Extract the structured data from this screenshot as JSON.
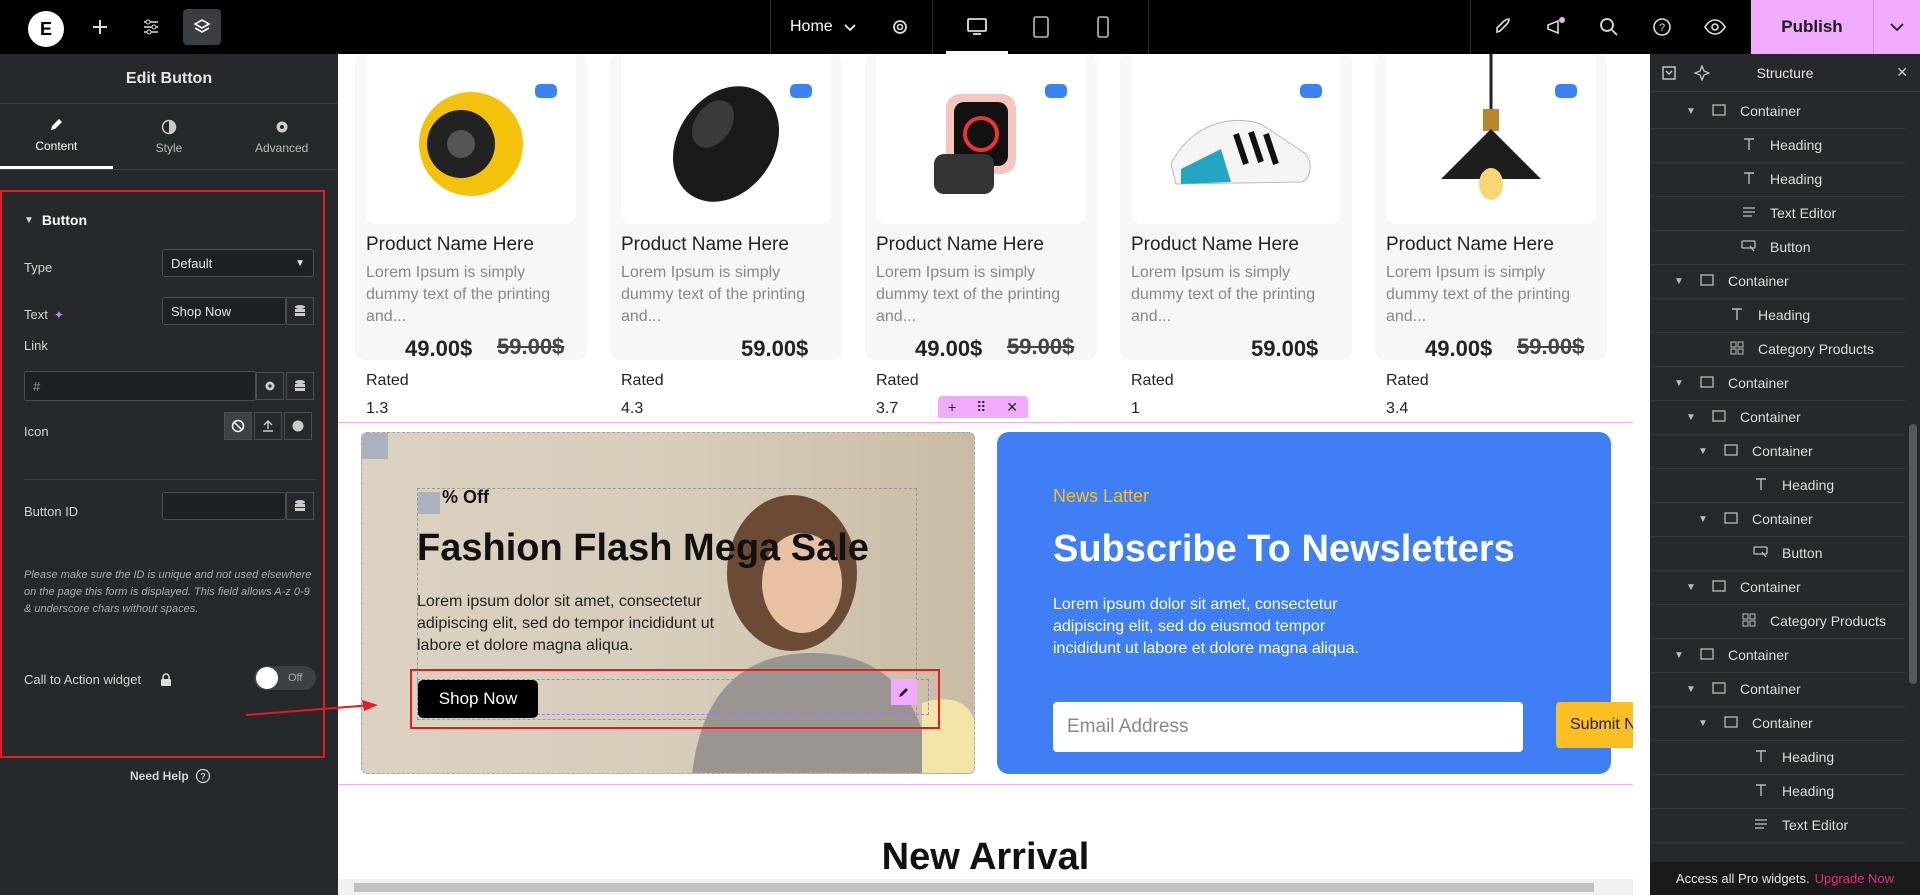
{
  "topbar": {
    "logo": "E",
    "home_label": "Home",
    "publish_label": "Publish"
  },
  "left_panel": {
    "title": "Edit Button",
    "tabs": [
      {
        "label": "Content",
        "icon": "pencil-icon"
      },
      {
        "label": "Style",
        "icon": "half-circle-icon"
      },
      {
        "label": "Advanced",
        "icon": "gear-icon"
      }
    ],
    "section_title": "Button",
    "type_label": "Type",
    "type_value": "Default",
    "text_label": "Text",
    "text_value": "Shop Now",
    "link_label": "Link",
    "link_placeholder": "#",
    "icon_label": "Icon",
    "button_id_label": "Button ID",
    "note": "Please make sure the ID is unique and not used elsewhere on the page this form is displayed. This field allows A-z 0-9 & underscore chars without spaces.",
    "cta_label": "Call to Action widget",
    "cta_toggle": "Off",
    "help_label": "Need Help"
  },
  "products": [
    {
      "name": "Product Name Here",
      "desc": "Lorem Ipsum is simply dummy text of the printing and...",
      "price": "49.00$",
      "old_price": "59.00$",
      "rated_label": "Rated",
      "rating": "1.3",
      "image": "speaker"
    },
    {
      "name": "Product Name Here",
      "desc": "Lorem Ipsum is simply dummy text of the printing and...",
      "price": "59.00$",
      "old_price": "",
      "rated_label": "Rated",
      "rating": "4.3",
      "image": "mouse"
    },
    {
      "name": "Product Name Here",
      "desc": "Lorem Ipsum is simply dummy text of the printing and...",
      "price": "49.00$",
      "old_price": "59.00$",
      "rated_label": "Rated",
      "rating": "3.7",
      "image": "smartwatch"
    },
    {
      "name": "Product Name Here",
      "desc": "Lorem Ipsum is simply dummy text of the printing and...",
      "price": "59.00$",
      "old_price": "",
      "rated_label": "Rated",
      "rating": "1",
      "image": "sneaker"
    },
    {
      "name": "Product Name Here",
      "desc": "Lorem Ipsum is simply dummy text of the printing and...",
      "price": "49.00$",
      "old_price": "59.00$",
      "rated_label": "Rated",
      "rating": "3.4",
      "image": "lamp"
    }
  ],
  "promo": {
    "badge": "% Off",
    "title": "Fashion Flash Mega Sale",
    "text": "Lorem ipsum dolor sit amet, consectetur adipiscing elit, sed do tempor incididunt ut labore et dolore magna aliqua.",
    "button": "Shop Now"
  },
  "newsletter": {
    "eyebrow": "News Latter",
    "title": "Subscribe To Newsletters",
    "text": "Lorem ipsum dolor sit amet, consectetur adipiscing elit, sed do eiusmod tempor incididunt ut labore et dolore magna aliqua.",
    "email_placeholder": "Email Address",
    "submit": "Submit N"
  },
  "new_arrival": "New Arrival",
  "structure": {
    "title": "Structure",
    "items": [
      {
        "label": "Container",
        "type": "container",
        "level": 2,
        "caret": true
      },
      {
        "label": "Heading",
        "type": "heading",
        "level": 3
      },
      {
        "label": "Heading",
        "type": "heading",
        "level": 3
      },
      {
        "label": "Text Editor",
        "type": "text",
        "level": 3
      },
      {
        "label": "Button",
        "type": "button",
        "level": 3
      },
      {
        "label": "Container",
        "type": "container",
        "level": 1,
        "caret": true
      },
      {
        "label": "Heading",
        "type": "heading",
        "level": 2
      },
      {
        "label": "Category Products",
        "type": "grid",
        "level": 2
      },
      {
        "label": "Container",
        "type": "container",
        "level": 1,
        "caret": true
      },
      {
        "label": "Container",
        "type": "container",
        "level": 2,
        "caret": true
      },
      {
        "label": "Container",
        "type": "container",
        "level": 3,
        "caret": true
      },
      {
        "label": "Heading",
        "type": "heading",
        "level": 4
      },
      {
        "label": "Container",
        "type": "container",
        "level": 3,
        "caret": true
      },
      {
        "label": "Button",
        "type": "button",
        "level": 4
      },
      {
        "label": "Container",
        "type": "container",
        "level": 2,
        "caret": true
      },
      {
        "label": "Category Products",
        "type": "grid",
        "level": 3
      },
      {
        "label": "Container",
        "type": "container",
        "level": 1,
        "caret": true
      },
      {
        "label": "Container",
        "type": "container",
        "level": 2,
        "caret": true
      },
      {
        "label": "Container",
        "type": "container",
        "level": 3,
        "caret": true
      },
      {
        "label": "Heading",
        "type": "heading",
        "level": 4
      },
      {
        "label": "Heading",
        "type": "heading",
        "level": 4
      },
      {
        "label": "Text Editor",
        "type": "text",
        "level": 4
      }
    ],
    "footer_text": "Access all Pro widgets.",
    "footer_link": "Upgrade Now"
  },
  "colors": {
    "accent": "#f0abfc",
    "newsletter_bg": "#3f7ef5",
    "highlight": "#e31b23",
    "submit": "#fbbf24",
    "eyebrow": "#fbbf24",
    "upgrade": "#e0307e"
  }
}
